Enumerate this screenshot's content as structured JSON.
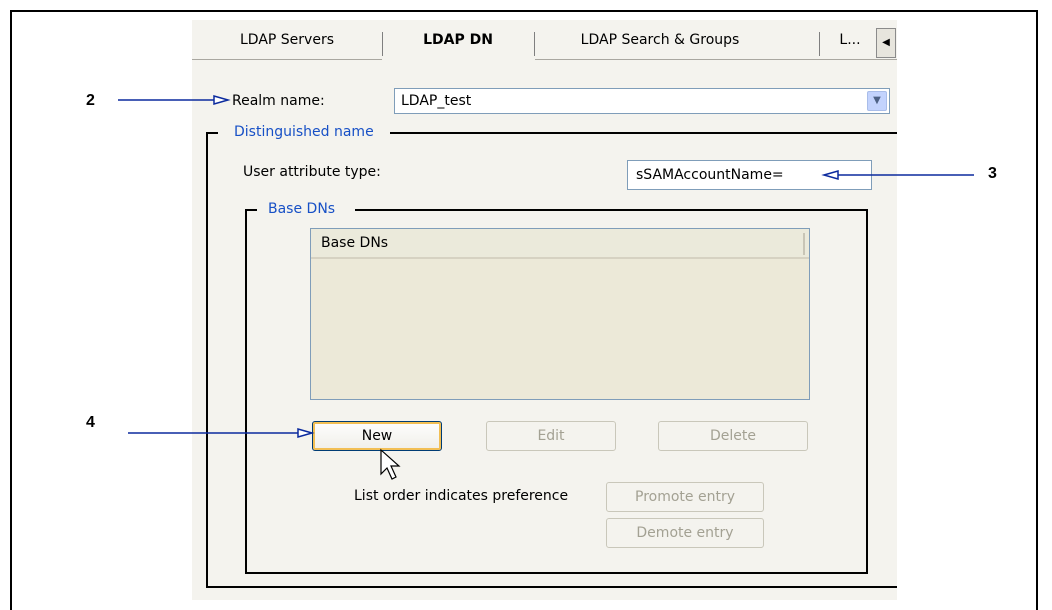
{
  "tabs": [
    {
      "label": "LDAP Servers",
      "active": false
    },
    {
      "label": "LDAP DN",
      "active": true
    },
    {
      "label": "LDAP Search & Groups",
      "active": false
    },
    {
      "label": "L...",
      "active": false
    }
  ],
  "realm": {
    "label": "Realm name:",
    "value": "LDAP_test"
  },
  "distinguished_name": {
    "group_label": "Distinguished name",
    "user_attr_label": "User attribute type:",
    "user_attr_value": "sSAMAccountName="
  },
  "base_dns": {
    "group_label": "Base DNs",
    "column_header": "Base DNs",
    "rows": []
  },
  "buttons": {
    "new": "New",
    "edit": "Edit",
    "delete": "Delete",
    "promote": "Promote entry",
    "demote": "Demote entry"
  },
  "list_order_note": "List order indicates preference",
  "callouts": {
    "c2": "2",
    "c3": "3",
    "c4": "4"
  },
  "colors": {
    "group_label": "#1750c6",
    "focus_ring": "#f2bf54",
    "panel_bg": "#f4f3ee"
  }
}
